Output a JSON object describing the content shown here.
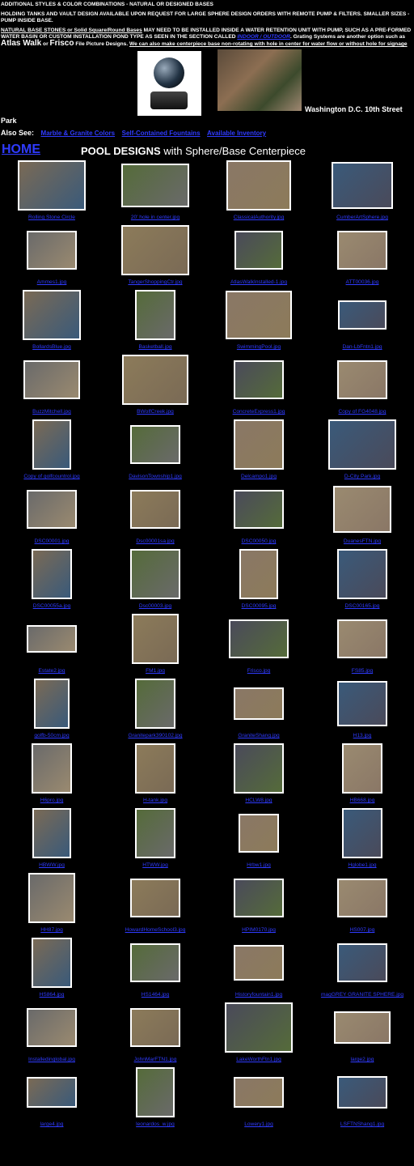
{
  "header": {
    "line1": "ADDITIONAL STYLES & COLOR COMBINATIONS  - NATURAL OR DESIGNED BASES",
    "line2": "HOLDING TANKS AND VAULT DESIGN AVAILABLE UPON REQUEST FOR LARGE SPHERE DESIGN ORDERS WITH REMOTE PUMP & FILTERS.  SMALLER SIZES - PUMP INSIDE BASE.",
    "line3a": "NATURAL BASE STONES or Solid Square/Round Bases",
    "line3b": " MAY NEED TO BE INSTALLED INSIDE A WATER RETENTION UNIT WITH PUMP, SUCH AS A PRE-FORMED WATER BASIN OR CUSTOM INSTALLATION POND TYPE AS SEEN IN THE SECTION CALLED ",
    "indoor_link": "INDOOR / OUTDOOR",
    "line3c": ".  Grating Systems are another option such as ",
    "atlas": "Atlas Walk",
    "or": " or ",
    "frisco": "Frisco",
    "line3d": " File Picture Designs.   ",
    "line3e": "We can also make centerpiece base non-rotating with hole in center for water flow or without hole for signage",
    "washington": "Washington D.C. 10th Street",
    "park": "Park"
  },
  "also_see": {
    "label": "Also See:",
    "links": [
      "Marble & Granite Colors",
      "Self-Contained Fountains",
      "Available Inventory"
    ]
  },
  "nav": {
    "home": "HOME"
  },
  "page_title": {
    "bold": "POOL DESIGNS",
    "rest": " with Sphere/Base Centerpiece"
  },
  "thumbnails": [
    "Rolling Stone Circle",
    "20' hole in center.jpg",
    "ClassicalAuthority.jpg",
    "CumberArtSphere.jpg",
    "Ammes1.jpg",
    "TangerShoppingCtr.jpg",
    "AtlasWalkInstalled-1.jpg",
    "ATT00036.jpg",
    "BollardsBlue.jpg",
    "Basketball.jpg",
    "SwimmingPool.jpg",
    "Dan-LbFntn1.jpg",
    "BuzzMitchell.jpg",
    "BWolfCreek.jpg",
    "ConcreteExpress1.jpg",
    "Copy of FG4048.jpg",
    "Copy of golfcountrol.jpg",
    "DavisonTownship1.jpg",
    "Delcampo1.jpg",
    "D-City Park.jpg",
    "DSC00001.jpg",
    "Dsc00001sa.jpg",
    "DSC00050.jpg",
    "DuanesFTN.jpg",
    "DSC00055a.jpg",
    "Dsc00003.jpg",
    "DSC00095.jpg",
    "DSC00165.jpg",
    "Estate2.jpg",
    "FM1.jpg",
    "Frisco.jpg",
    "FS85.jpg",
    "golfb-50cm.jpg",
    "Granitepark390102.jpg",
    "GraniteShang.jpg",
    "H13.jpg",
    "H6pro.jpg",
    "H-tank.jpg",
    "HCLW8.jpg",
    "HB668.jpg",
    "HBWW.jpg",
    "HTWW.jpg",
    "Hrbw1.jpg",
    "Hglobe1.jpg",
    "HH87.jpg",
    "HowardHomeSchool3.jpg",
    "HPIM0170.jpg",
    "HS007.jpg",
    "HS864.jpg",
    "HS1464.jpg",
    "Historyfountain1.jpg",
    "magGREY GRANITE SPHERE.jpg",
    "Installedinglobal.jpg",
    "JohnMarFTN1.jpg",
    "LakeWorthFtn1.jpg",
    "large2.jpg",
    "large4.jpg",
    "leonardos_w.jpg",
    "Lowery1.jpg",
    "LSFTNShang1.jpg"
  ]
}
